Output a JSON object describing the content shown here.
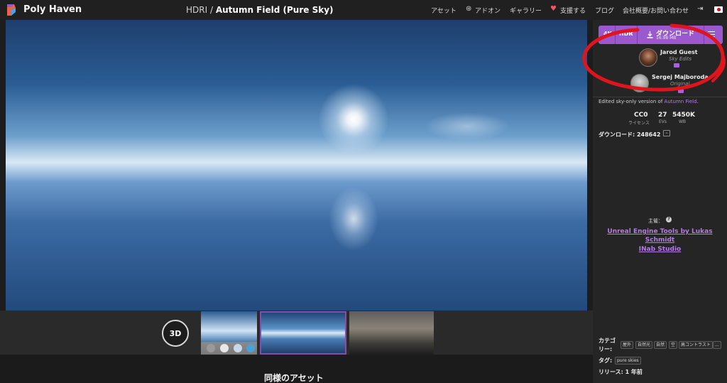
{
  "header": {
    "brand": "Poly Haven",
    "breadcrumb_section": "HDRI",
    "breadcrumb_sep": "/",
    "asset_title": "Autumn Field (Pure Sky)",
    "nav": {
      "assets": "アセット",
      "addons": "アドオン",
      "gallery": "ギャラリー",
      "support": "支援する",
      "blog": "ブログ",
      "company": "会社概要/お問い合わせ"
    }
  },
  "viewer": {
    "btn_3d": "3D",
    "similar_title": "同様のアセット"
  },
  "sidebar": {
    "download": {
      "resolution": "4K",
      "format": "HDR",
      "label": "ダウンロード",
      "size": "16.98 MB"
    },
    "authors": [
      {
        "name": "Jarod Guest",
        "role": "Sky Edits"
      },
      {
        "name": "Sergej Majboroda",
        "role": "Original"
      }
    ],
    "description_prefix": "Edited sky-only version of ",
    "description_link": "Autumn Field",
    "description_suffix": ".",
    "stats": [
      {
        "value": "CC0",
        "label": "ライセンス"
      },
      {
        "value": "27",
        "label": "EVs"
      },
      {
        "value": "5450K",
        "label": "WB"
      }
    ],
    "downloads_label": "ダウンロード: 248642",
    "sponsor_heading": "主催：",
    "sponsors": [
      "Unreal Engine Tools by Lukas",
      "Schmidt",
      "INab Studio"
    ],
    "categories_label_1": "カテゴ",
    "categories_label_2": "リー:",
    "categories": [
      "屋外",
      "自然光",
      "自然",
      "空",
      "高コントラスト",
      "..."
    ],
    "tags_label": "タグ:",
    "tags": [
      "pure skies"
    ],
    "release_label": "リリース: 1 年前"
  },
  "colors": {
    "accent": "#9b59d0",
    "link": "#b57ae8",
    "annotation": "#e0141c"
  }
}
